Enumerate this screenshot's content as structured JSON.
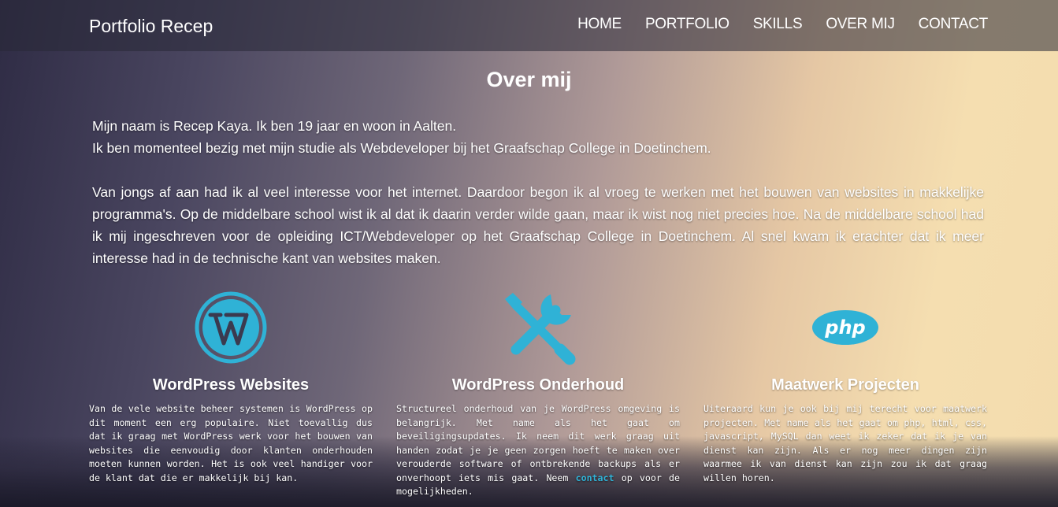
{
  "header": {
    "brand": "Portfolio Recep",
    "nav": [
      "HOME",
      "PORTFOLIO",
      "SKILLS",
      "OVER MIJ",
      "CONTACT"
    ]
  },
  "about": {
    "title": "Over mij",
    "line1": "Mijn naam is Recep Kaya. Ik ben 19 jaar en woon in Aalten.",
    "line2": "Ik ben momenteel bezig met mijn studie als Webdeveloper bij het Graafschap College in Doetinchem.",
    "paragraph": "Van jongs af aan had ik al veel interesse voor het internet. Daardoor begon ik al vroeg te werken met het bouwen van websites in makkelijke programma's. Op de middelbare school wist ik al dat ik daarin verder wilde gaan, maar ik wist nog niet precies hoe. Na de middelbare school had ik mij ingeschreven voor de opleiding ICT/Webdeveloper op het Graafschap College in Doetinchem. Al snel kwam ik erachter dat ik meer interesse had in de technische kant van websites maken."
  },
  "services": [
    {
      "icon": "wordpress-icon",
      "title": "WordPress Websites",
      "text": "Van de vele website beheer systemen is WordPress op dit moment een erg populaire. Niet toevallig dus dat ik graag met WordPress werk voor het bouwen van websites die eenvoudig door klanten onderhouden moeten kunnen worden. Het is ook veel handiger voor de klant dat die er makkelijk bij kan."
    },
    {
      "icon": "tools-icon",
      "title": "WordPress Onderhoud",
      "text_before": "Structureel onderhoud van je WordPress omgeving is belangrijk. Met name als het gaat om beveiligingsupdates. Ik neem dit werk graag uit handen zodat je je geen zorgen hoeft te maken over verouderde software of ontbrekende backups als er onverhoopt iets mis gaat. Neem ",
      "link": "contact",
      "text_after": " op voor de mogelijkheden."
    },
    {
      "icon": "php-icon",
      "title": "Maatwerk Projecten",
      "text": "Uiteraard kun je ook bij mij terecht voor maatwerk projecten. Met name als het gaat om php, html, css, javascript, MySQL dan weet ik zeker dat ik je van dienst kan zijn. Als er nog meer dingen zijn waarmee ik van dienst kan zijn zou ik dat graag willen horen."
    }
  ],
  "colors": {
    "accent": "#2fb2d6",
    "navbar": "#3a3a4c"
  }
}
